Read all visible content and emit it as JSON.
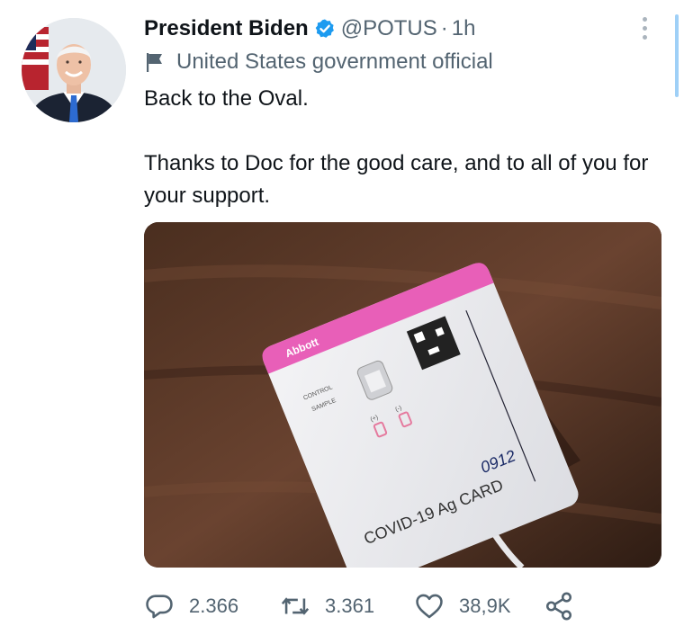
{
  "tweet": {
    "author": {
      "display_name": "President Biden",
      "handle": "@POTUS",
      "separator": "·",
      "time": "1h",
      "verified": true,
      "label": "United States government official"
    },
    "text_lines": [
      "Back to the Oval.",
      "Thanks to Doc for the good care, and to all of you for your support."
    ],
    "media": {
      "card_brand": "Abbott",
      "card_labels": [
        "CONTROL",
        "SAMPLE",
        "(+)",
        "(-)"
      ],
      "card_title": "COVID-19 Ag CARD",
      "card_handwriting": "0912"
    },
    "stats": {
      "replies": "2.366",
      "retweets": "3.361",
      "likes": "38,9K"
    }
  },
  "icons": {
    "more": "more-vertical-icon",
    "verified": "verified-badge-icon",
    "label": "flag-icon",
    "reply": "reply-icon",
    "retweet": "retweet-icon",
    "like": "heart-icon",
    "share": "share-icon"
  },
  "colors": {
    "verified_badge": "#1d9bf0",
    "text_primary": "#0f1419",
    "text_secondary": "#536471",
    "card_accent": "#e85fb8"
  }
}
